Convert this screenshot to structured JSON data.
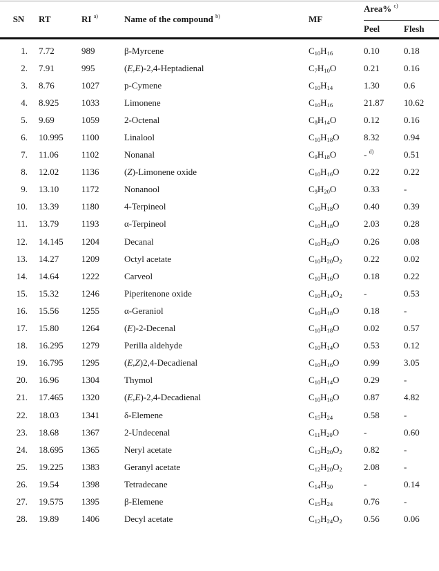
{
  "table": {
    "headers": {
      "sn": "SN",
      "rt": "RT",
      "ri": "RI",
      "ri_note": "a)",
      "name": "Name of the compound",
      "name_note": "b)",
      "mf": "MF",
      "area": "Area%",
      "area_note": "c)",
      "peel": "Peel",
      "flesh": "Flesh"
    },
    "rows": [
      {
        "sn": "1.",
        "rt": "7.72",
        "ri": "989",
        "name": [
          {
            "t": "β-Myrcene"
          }
        ],
        "mf": [
          [
            "C",
            "10"
          ],
          [
            "H",
            "16"
          ]
        ],
        "peel": "0.10",
        "flesh": "0.18"
      },
      {
        "sn": "2.",
        "rt": "7.91",
        "ri": "995",
        "name": [
          {
            "t": "(",
            "i": false
          },
          {
            "t": "E,E",
            "i": true
          },
          {
            "t": ")-2,4-Heptadienal"
          }
        ],
        "mf": [
          [
            "C",
            "7"
          ],
          [
            "H",
            "10"
          ],
          [
            "O",
            ""
          ]
        ],
        "peel": "0.21",
        "flesh": "0.16"
      },
      {
        "sn": "3.",
        "rt": "8.76",
        "ri": "1027",
        "name": [
          {
            "t": "p-Cymene"
          }
        ],
        "mf": [
          [
            "C",
            "10"
          ],
          [
            "H",
            "14"
          ]
        ],
        "peel": "1.30",
        "flesh": "0.6"
      },
      {
        "sn": "4.",
        "rt": "8.925",
        "ri": "1033",
        "name": [
          {
            "t": "Limonene"
          }
        ],
        "mf": [
          [
            "C",
            "10"
          ],
          [
            "H",
            "16"
          ]
        ],
        "peel": "21.87",
        "flesh": "10.62"
      },
      {
        "sn": "5.",
        "rt": "9.69",
        "ri": "1059",
        "name": [
          {
            "t": "2-Octenal"
          }
        ],
        "mf": [
          [
            "C",
            "8"
          ],
          [
            "H",
            "14"
          ],
          [
            "O",
            ""
          ]
        ],
        "peel": "0.12",
        "flesh": "0.16"
      },
      {
        "sn": "6.",
        "rt": "10.995",
        "ri": "1100",
        "name": [
          {
            "t": "Linalool"
          }
        ],
        "mf": [
          [
            "C",
            "10"
          ],
          [
            "H",
            "18"
          ],
          [
            "O",
            ""
          ]
        ],
        "peel": "8.32",
        "flesh": "0.94"
      },
      {
        "sn": "7.",
        "rt": "11.06",
        "ri": "1102",
        "name": [
          {
            "t": "Nonanal"
          }
        ],
        "mf": [
          [
            "C",
            "9"
          ],
          [
            "H",
            "18"
          ],
          [
            "O",
            ""
          ]
        ],
        "peel": "-",
        "peel_note": "d)",
        "flesh": "0.51"
      },
      {
        "sn": "8.",
        "rt": "12.02",
        "ri": "1136",
        "name": [
          {
            "t": "("
          },
          {
            "t": "Z",
            "i": true
          },
          {
            "t": ")-Limonene oxide"
          }
        ],
        "mf": [
          [
            "C",
            "10"
          ],
          [
            "H",
            "16"
          ],
          [
            "O",
            ""
          ]
        ],
        "peel": "0.22",
        "flesh": "0.22"
      },
      {
        "sn": "9.",
        "rt": "13.10",
        "ri": "1172",
        "name": [
          {
            "t": "Nonanool"
          }
        ],
        "mf": [
          [
            "C",
            "9"
          ],
          [
            "H",
            "20"
          ],
          [
            "O",
            ""
          ]
        ],
        "peel": "0.33",
        "flesh": "-"
      },
      {
        "sn": "10.",
        "rt": "13.39",
        "ri": "1180",
        "name": [
          {
            "t": "4-Terpineol"
          }
        ],
        "mf": [
          [
            "C",
            "10"
          ],
          [
            "H",
            "18"
          ],
          [
            "O",
            ""
          ]
        ],
        "peel": "0.40",
        "flesh": "0.39"
      },
      {
        "sn": "11.",
        "rt": "13.79",
        "ri": "1193",
        "name": [
          {
            "t": "α-Terpineol"
          }
        ],
        "mf": [
          [
            "C",
            "10"
          ],
          [
            "H",
            "18"
          ],
          [
            "O",
            ""
          ]
        ],
        "peel": "2.03",
        "flesh": "0.28"
      },
      {
        "sn": "12.",
        "rt": "14.145",
        "ri": "1204",
        "name": [
          {
            "t": "Decanal"
          }
        ],
        "mf": [
          [
            "C",
            "10"
          ],
          [
            "H",
            "20"
          ],
          [
            "O",
            ""
          ]
        ],
        "peel": "0.26",
        "flesh": "0.08"
      },
      {
        "sn": "13.",
        "rt": "14.27",
        "ri": "1209",
        "name": [
          {
            "t": "Octyl acetate"
          }
        ],
        "mf": [
          [
            "C",
            "10"
          ],
          [
            "H",
            "20"
          ],
          [
            "O",
            "2"
          ]
        ],
        "peel": "0.22",
        "flesh": "0.02"
      },
      {
        "sn": "14.",
        "rt": "14.64",
        "ri": "1222",
        "name": [
          {
            "t": "Carveol"
          }
        ],
        "mf": [
          [
            "C",
            "10"
          ],
          [
            "H",
            "16"
          ],
          [
            "O",
            ""
          ]
        ],
        "peel": "0.18",
        "flesh": "0.22"
      },
      {
        "sn": "15.",
        "rt": "15.32",
        "ri": "1246",
        "name": [
          {
            "t": "Piperitenone oxide"
          }
        ],
        "mf": [
          [
            "C",
            "10"
          ],
          [
            "H",
            "14"
          ],
          [
            "O",
            "2"
          ]
        ],
        "peel": "-",
        "flesh": "0.53"
      },
      {
        "sn": "16.",
        "rt": "15.56",
        "ri": "1255",
        "name": [
          {
            "t": "α-Geraniol"
          }
        ],
        "mf": [
          [
            "C",
            "10"
          ],
          [
            "H",
            "18"
          ],
          [
            "O",
            ""
          ]
        ],
        "peel": "0.18",
        "flesh": "-"
      },
      {
        "sn": "17.",
        "rt": "15.80",
        "ri": "1264",
        "name": [
          {
            "t": "("
          },
          {
            "t": "E",
            "i": true
          },
          {
            "t": ")-2-Decenal"
          }
        ],
        "mf": [
          [
            "C",
            "10"
          ],
          [
            "H",
            "18"
          ],
          [
            "O",
            ""
          ]
        ],
        "peel": "0.02",
        "flesh": "0.57"
      },
      {
        "sn": "18.",
        "rt": "16.295",
        "ri": "1279",
        "name": [
          {
            "t": "Perilla aldehyde"
          }
        ],
        "mf": [
          [
            "C",
            "10"
          ],
          [
            "H",
            "14"
          ],
          [
            "O",
            ""
          ]
        ],
        "peel": "0.53",
        "flesh": "0.12"
      },
      {
        "sn": "19.",
        "rt": "16.795",
        "ri": "1295",
        "name": [
          {
            "t": "("
          },
          {
            "t": "E,Z",
            "i": true
          },
          {
            "t": ")2,4-Decadienal"
          }
        ],
        "mf": [
          [
            "C",
            "10"
          ],
          [
            "H",
            "16"
          ],
          [
            "O",
            ""
          ]
        ],
        "peel": "0.99",
        "flesh": "3.05"
      },
      {
        "sn": "20.",
        "rt": "16.96",
        "ri": "1304",
        "name": [
          {
            "t": "Thymol"
          }
        ],
        "mf": [
          [
            "C",
            "10"
          ],
          [
            "H",
            "14"
          ],
          [
            "O",
            ""
          ]
        ],
        "peel": "0.29",
        "flesh": "-"
      },
      {
        "sn": "21.",
        "rt": "17.465",
        "ri": "1320",
        "name": [
          {
            "t": "("
          },
          {
            "t": "E,E",
            "i": true
          },
          {
            "t": ")-2,4-Decadienal"
          }
        ],
        "mf": [
          [
            "C",
            "10"
          ],
          [
            "H",
            "16"
          ],
          [
            "O",
            ""
          ]
        ],
        "peel": "0.87",
        "flesh": "4.82"
      },
      {
        "sn": "22.",
        "rt": "18.03",
        "ri": "1341",
        "name": [
          {
            "t": "δ-Elemene"
          }
        ],
        "mf": [
          [
            "C",
            "15"
          ],
          [
            "H",
            "24"
          ]
        ],
        "peel": "0.58",
        "flesh": "-"
      },
      {
        "sn": "23.",
        "rt": "18.68",
        "ri": "1367",
        "name": [
          {
            "t": "2-Undecenal"
          }
        ],
        "mf": [
          [
            "C",
            "11"
          ],
          [
            "H",
            "20"
          ],
          [
            "O",
            ""
          ]
        ],
        "peel": "-",
        "flesh": "0.60"
      },
      {
        "sn": "24.",
        "rt": "18.695",
        "ri": "1365",
        "name": [
          {
            "t": "Neryl acetate"
          }
        ],
        "mf": [
          [
            "C",
            "12"
          ],
          [
            "H",
            "20"
          ],
          [
            "O",
            "2"
          ]
        ],
        "peel": "0.82",
        "flesh": "-"
      },
      {
        "sn": "25.",
        "rt": "19.225",
        "ri": "1383",
        "name": [
          {
            "t": "Geranyl acetate"
          }
        ],
        "mf": [
          [
            "C",
            "12"
          ],
          [
            "H",
            "20"
          ],
          [
            "O",
            "2"
          ]
        ],
        "peel": "2.08",
        "flesh": "-"
      },
      {
        "sn": "26.",
        "rt": "19.54",
        "ri": "1398",
        "name": [
          {
            "t": "Tetradecane"
          }
        ],
        "mf": [
          [
            "C",
            "14"
          ],
          [
            "H",
            "30"
          ]
        ],
        "peel": "-",
        "flesh": "0.14"
      },
      {
        "sn": "27.",
        "rt": "19.575",
        "ri": "1395",
        "name": [
          {
            "t": "β-Elemene"
          }
        ],
        "mf": [
          [
            "C",
            "15"
          ],
          [
            "H",
            "24"
          ]
        ],
        "peel": "0.76",
        "flesh": "-"
      },
      {
        "sn": "28.",
        "rt": "19.89",
        "ri": "1406",
        "name": [
          {
            "t": "Decyl acetate"
          }
        ],
        "mf": [
          [
            "C",
            "12"
          ],
          [
            "H",
            "24"
          ],
          [
            "O",
            "2"
          ]
        ],
        "peel": "0.56",
        "flesh": "0.06"
      }
    ]
  }
}
